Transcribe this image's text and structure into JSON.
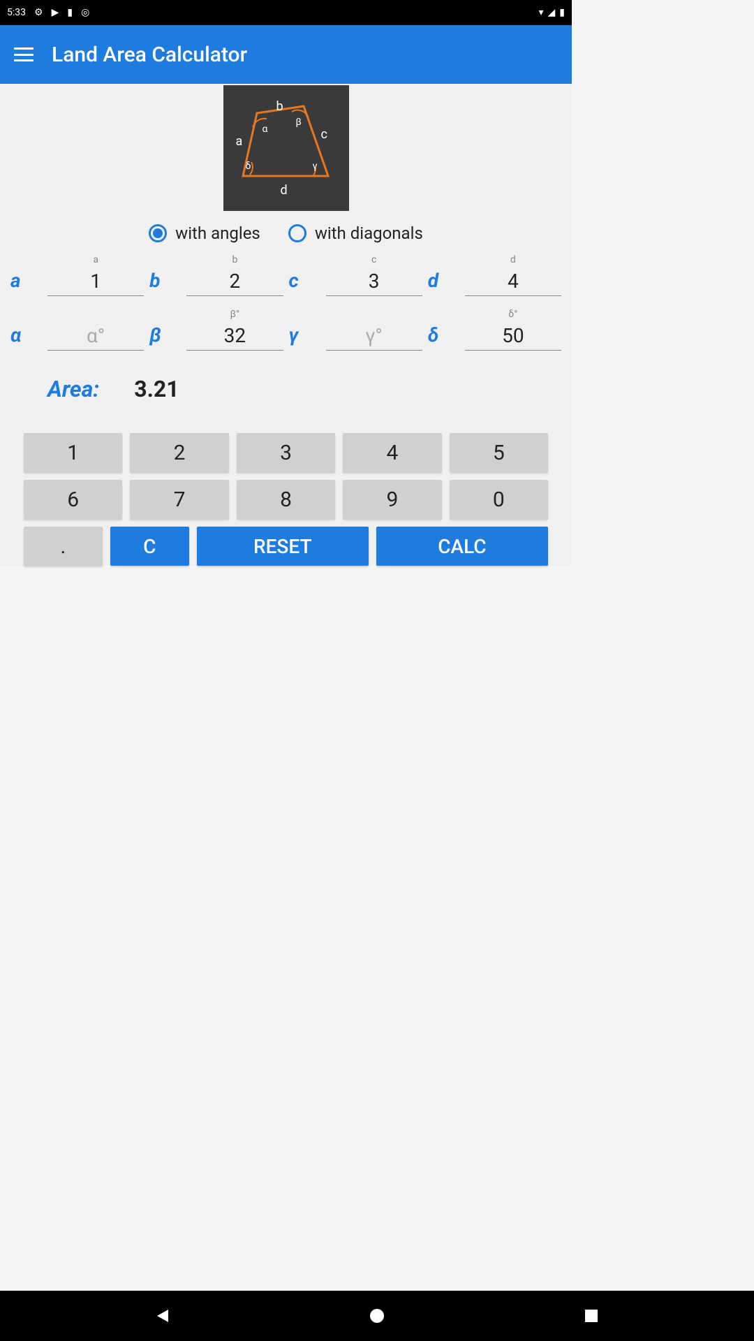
{
  "statusBar": {
    "time": "5:33"
  },
  "appBar": {
    "title": "Land Area Calculator"
  },
  "diagram": {
    "labels": {
      "a": "a",
      "b": "b",
      "c": "c",
      "d": "d",
      "alpha": "α",
      "beta": "β",
      "gamma": "γ",
      "delta": "δ"
    }
  },
  "radios": {
    "withAngles": "with angles",
    "withDiagonals": "with diagonals",
    "selected": "withAngles"
  },
  "sideLabels": {
    "a": "a",
    "b": "b",
    "c": "c",
    "d": "d"
  },
  "angleLabels": {
    "alpha": "α",
    "beta": "β",
    "gamma": "γ",
    "delta": "δ"
  },
  "hints": {
    "a": "a",
    "b": "b",
    "c": "c",
    "d": "d",
    "alpha": "α°",
    "beta": "β°",
    "gamma": "γ°",
    "delta": "δ°"
  },
  "inputs": {
    "a": "1",
    "b": "2",
    "c": "3",
    "d": "4",
    "alpha": "",
    "beta": "32",
    "gamma": "",
    "delta": "50"
  },
  "placeholders": {
    "alpha": "α°",
    "gamma": "γ°"
  },
  "result": {
    "label": "Area:",
    "value": "3.21"
  },
  "keypad": {
    "digits": [
      "1",
      "2",
      "3",
      "4",
      "5",
      "6",
      "7",
      "8",
      "9",
      "0"
    ],
    "dot": ".",
    "clear": "C",
    "reset": "RESET",
    "calc": "CALC"
  },
  "colors": {
    "primary": "#1e7ce0"
  }
}
